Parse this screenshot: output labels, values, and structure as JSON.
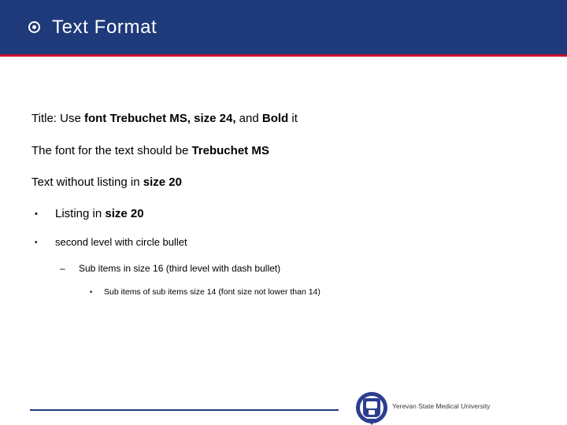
{
  "header": {
    "title": "Text Format",
    "bullet_icon": "circle-dot-icon",
    "band_color": "#1f3a7a",
    "accent_color": "#c8102e",
    "title_color": "#ffffff"
  },
  "body": {
    "line_title_plain_1": "Title: Use ",
    "line_title_bold": "font Trebuchet MS, size 24,",
    "line_title_plain_2": " and ",
    "line_title_bold_2": "Bold",
    "line_title_plain_3": " it",
    "line_font_plain": "The font for the text should be ",
    "line_font_bold": "Trebuchet MS",
    "line_nolist_plain": "Text without listing in ",
    "line_nolist_bold": "size 20",
    "bullet1_glyph": "•",
    "bullet1_plain": "Listing in ",
    "bullet1_bold": "size 20",
    "bullet2_glyph": "•",
    "bullet2_text": "second level with circle bullet",
    "bullet3_glyph": "–",
    "bullet3_text": "Sub items in size 16 (third level with dash bullet)",
    "bullet4_glyph": "•",
    "bullet4_text": "Sub items of sub items size 14 (font size not lower than 14)"
  },
  "footer": {
    "university": "Yerevan State Medical University",
    "rule_color": "#1f3a7a",
    "logo_icon": "university-crest-logo"
  }
}
